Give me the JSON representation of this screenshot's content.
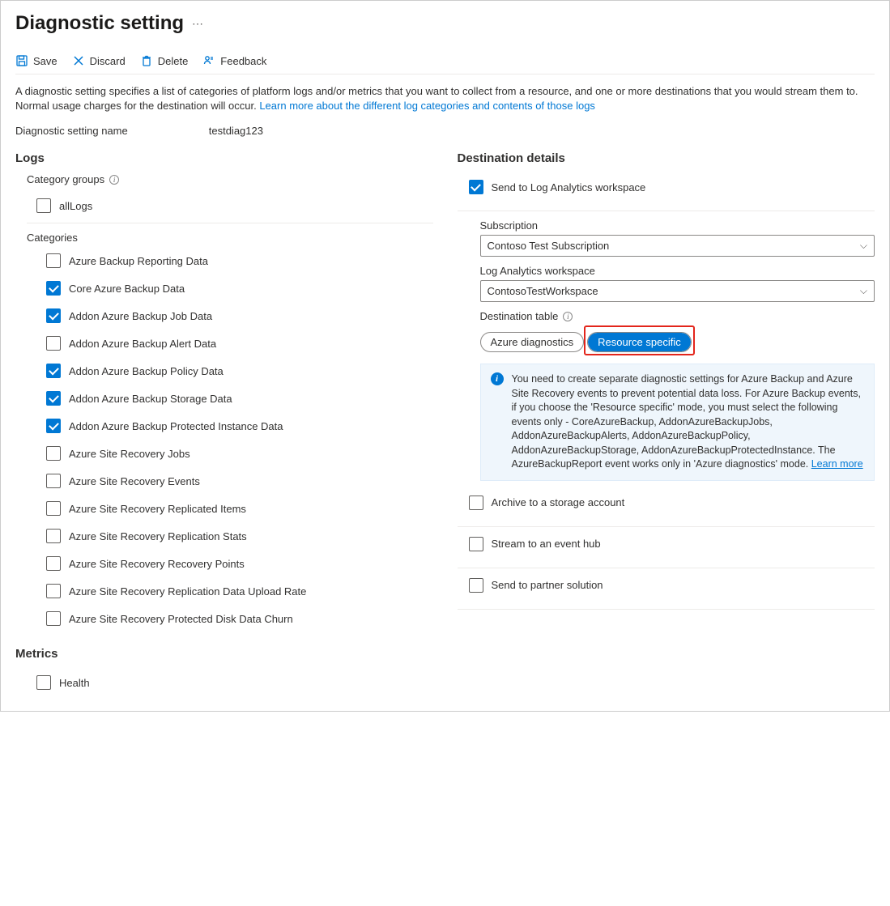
{
  "page_title": "Diagnostic setting",
  "toolbar": {
    "save": "Save",
    "discard": "Discard",
    "delete": "Delete",
    "feedback": "Feedback"
  },
  "description": {
    "text": "A diagnostic setting specifies a list of categories of platform logs and/or metrics that you want to collect from a resource, and one or more destinations that you would stream them to. Normal usage charges for the destination will occur. ",
    "link": "Learn more about the different log categories and contents of those logs"
  },
  "setting_name": {
    "label": "Diagnostic setting name",
    "value": "testdiag123"
  },
  "logs_title": "Logs",
  "category_groups": {
    "label": "Category groups",
    "items": [
      {
        "label": "allLogs",
        "checked": false
      }
    ]
  },
  "categories_label": "Categories",
  "categories": [
    {
      "label": "Azure Backup Reporting Data",
      "checked": false
    },
    {
      "label": "Core Azure Backup Data",
      "checked": true
    },
    {
      "label": "Addon Azure Backup Job Data",
      "checked": true
    },
    {
      "label": "Addon Azure Backup Alert Data",
      "checked": false
    },
    {
      "label": "Addon Azure Backup Policy Data",
      "checked": true
    },
    {
      "label": "Addon Azure Backup Storage Data",
      "checked": true
    },
    {
      "label": "Addon Azure Backup Protected Instance Data",
      "checked": true
    },
    {
      "label": "Azure Site Recovery Jobs",
      "checked": false
    },
    {
      "label": "Azure Site Recovery Events",
      "checked": false
    },
    {
      "label": "Azure Site Recovery Replicated Items",
      "checked": false
    },
    {
      "label": "Azure Site Recovery Replication Stats",
      "checked": false
    },
    {
      "label": "Azure Site Recovery Recovery Points",
      "checked": false
    },
    {
      "label": "Azure Site Recovery Replication Data Upload Rate",
      "checked": false
    },
    {
      "label": "Azure Site Recovery Protected Disk Data Churn",
      "checked": false
    }
  ],
  "metrics_title": "Metrics",
  "metrics": [
    {
      "label": "Health",
      "checked": false
    }
  ],
  "dest_title": "Destination details",
  "destinations": {
    "log_analytics": {
      "label": "Send to Log Analytics workspace",
      "checked": true,
      "subscription_label": "Subscription",
      "subscription_value": "Contoso Test Subscription",
      "workspace_label": "Log Analytics workspace",
      "workspace_value": "ContosoTestWorkspace",
      "table_label": "Destination table",
      "table_opt_a": "Azure diagnostics",
      "table_opt_b": "Resource specific",
      "info_text": "You need to create separate diagnostic settings for Azure Backup and Azure Site Recovery events to prevent potential data loss. For Azure Backup events, if you choose the 'Resource specific' mode, you must select the following events only - CoreAzureBackup, AddonAzureBackupJobs, AddonAzureBackupAlerts, AddonAzureBackupPolicy, AddonAzureBackupStorage, AddonAzureBackupProtectedInstance. The AzureBackupReport event works only in 'Azure diagnostics' mode.  ",
      "info_link": "Learn more"
    },
    "storage": {
      "label": "Archive to a storage account",
      "checked": false
    },
    "eventhub": {
      "label": "Stream to an event hub",
      "checked": false
    },
    "partner": {
      "label": "Send to partner solution",
      "checked": false
    }
  }
}
